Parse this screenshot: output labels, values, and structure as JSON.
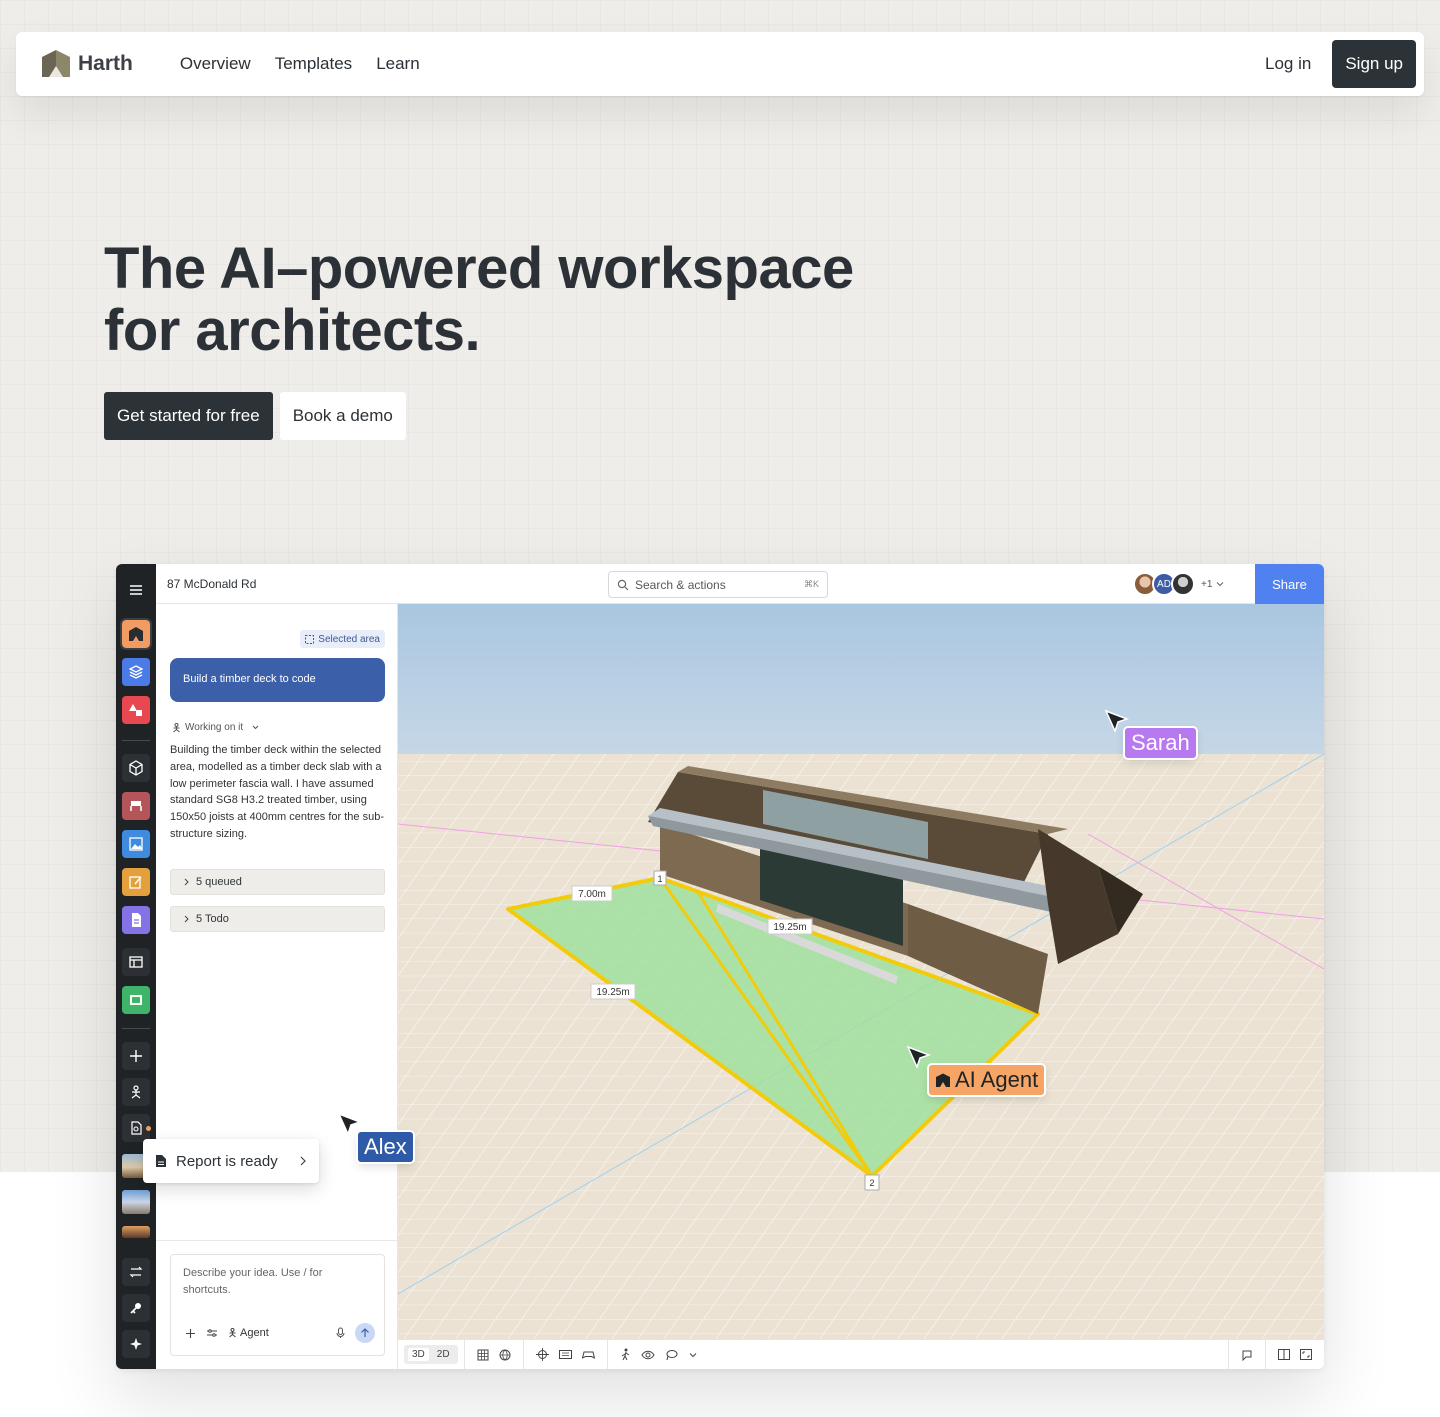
{
  "brand": {
    "name": "Harth"
  },
  "nav": {
    "links": [
      "Overview",
      "Templates",
      "Learn"
    ],
    "login": "Log in",
    "signup": "Sign up"
  },
  "hero": {
    "title_line1": "The AI–powered workspace",
    "title_line2": "for architects.",
    "cta_primary": "Get started for free",
    "cta_secondary": "Book a demo"
  },
  "app": {
    "project_name": "87 McDonald Rd",
    "search_placeholder": "Search & actions",
    "search_shortcut": "⌘K",
    "collaborators": {
      "initials": "AD",
      "more": "+1"
    },
    "share": "Share",
    "panel": {
      "selection_chip": "Selected area",
      "user_message": "Build a timber deck to code",
      "status": "Working on it",
      "agent_response": "Building the timber deck within the selected area, modelled as a timber deck slab with a low perimeter fascia wall. I have assumed standard SG8 H3.2 treated timber, using 150x50 joists at 400mm centres for the sub-structure sizing.",
      "queued": "5 queued",
      "todo": "5 Todo",
      "prompt_placeholder": "Describe your idea. Use / for shortcuts.",
      "mode": "Agent"
    },
    "toast": "Report is ready",
    "viewport": {
      "dimensions": [
        "7.00m",
        "19.25m",
        "19.25m"
      ],
      "vertices": [
        "1",
        "2"
      ]
    },
    "view_modes": [
      "3D",
      "2D"
    ],
    "cursors": [
      {
        "name": "Sarah",
        "color": "#b779f0"
      },
      {
        "name": "AI Agent",
        "color": "#f6a567"
      },
      {
        "name": "Alex",
        "color": "#2f5aa8"
      }
    ]
  },
  "colors": {
    "primary_dark": "#2b3338",
    "accent_blue": "#4f82f0",
    "selection_green": "#9be19b",
    "selection_outline": "#f2cc0c"
  }
}
